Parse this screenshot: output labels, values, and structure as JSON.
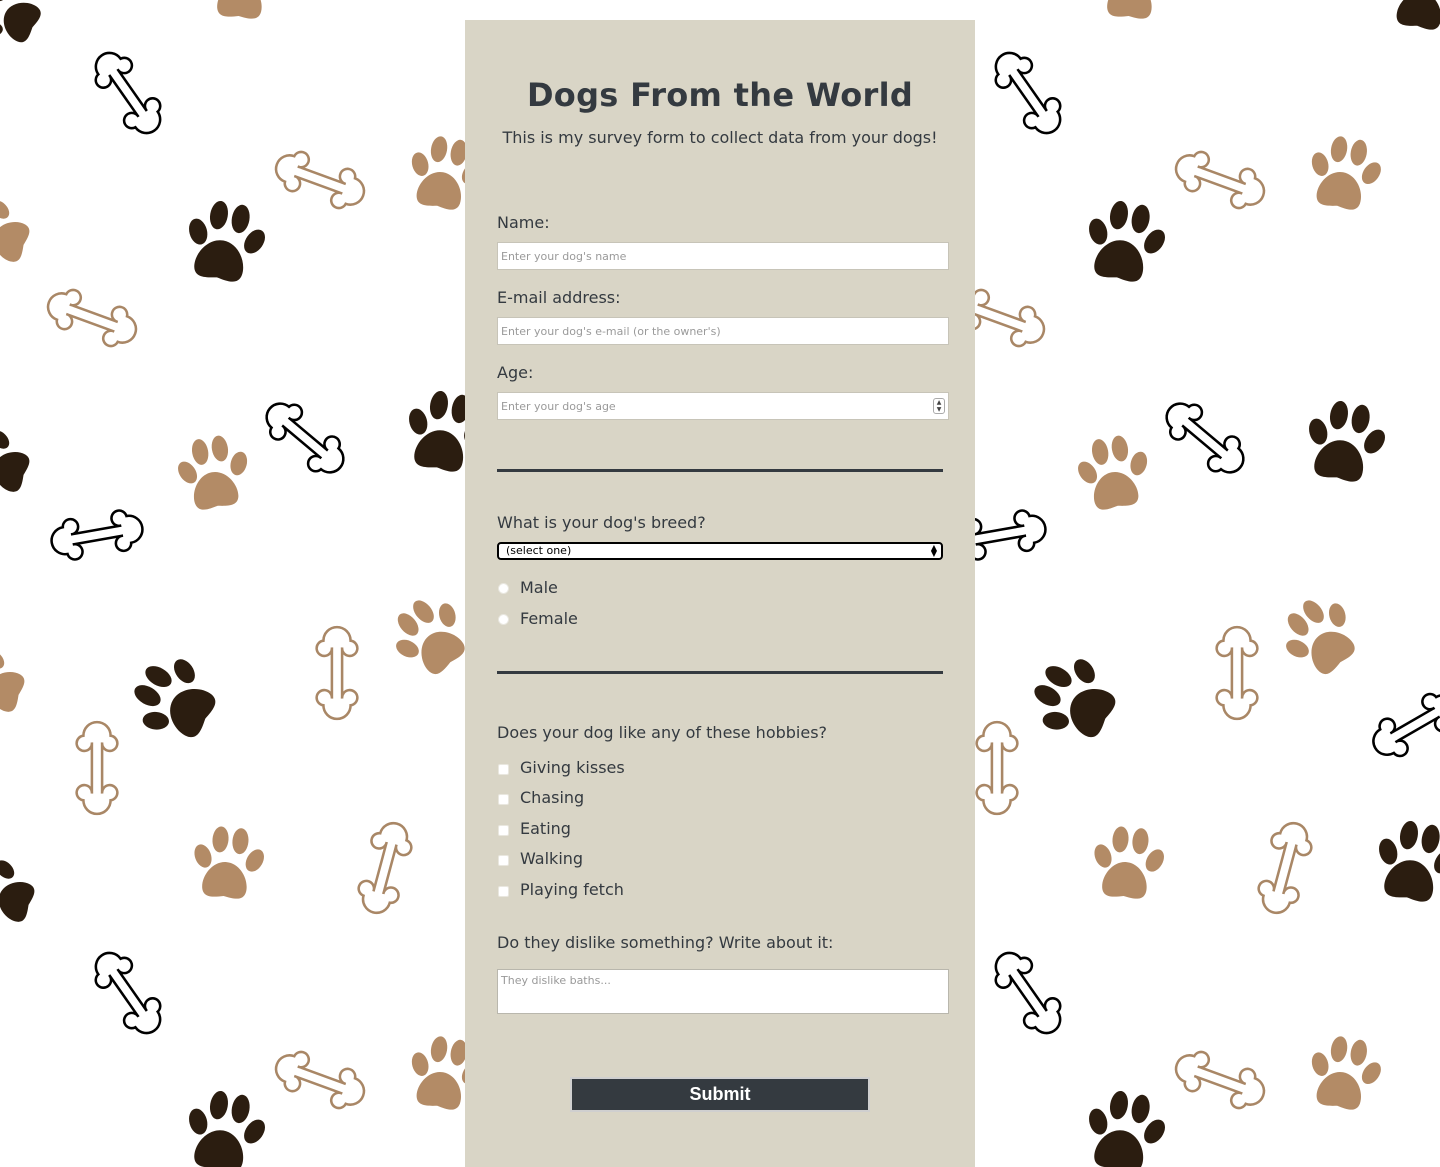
{
  "page": {
    "title": "Dogs From the World",
    "description": "This is my survey form to collect data from your dogs!"
  },
  "form": {
    "name": {
      "label": "Name:",
      "placeholder": "Enter your dog's name"
    },
    "email": {
      "label": "E-mail address:",
      "placeholder": "Enter your dog's e-mail (or the owner's)"
    },
    "age": {
      "label": "Age:",
      "placeholder": "Enter your dog's age"
    },
    "breed": {
      "label": "What is your dog's breed?",
      "selected": "(select one)"
    },
    "sex": {
      "options": [
        "Male",
        "Female"
      ]
    },
    "hobbies": {
      "label": "Does your dog like any of these hobbies?",
      "options": [
        "Giving kisses",
        "Chasing",
        "Eating",
        "Walking",
        "Playing fetch"
      ]
    },
    "dislikes": {
      "label": "Do they dislike something? Write about it:",
      "placeholder": "They dislike baths..."
    },
    "submit_label": "Submit"
  },
  "colors": {
    "card_background": "#d9d5c6",
    "text": "#343a40",
    "submit_background": "#343a40",
    "paw_dark": "#2b1d10",
    "paw_light": "#b38b66"
  },
  "icons": [
    "paw-print-icon",
    "dog-bone-icon"
  ]
}
